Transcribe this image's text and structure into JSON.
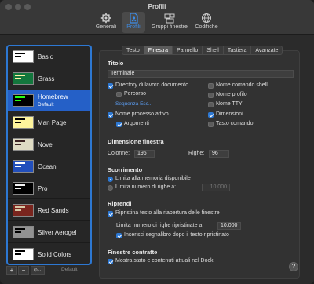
{
  "window": {
    "title": "Profili"
  },
  "toolbar": {
    "items": [
      {
        "label": "Generali",
        "icon": "gear-icon"
      },
      {
        "label": "Profili",
        "icon": "profile-doc-icon"
      },
      {
        "label": "Gruppi finestre",
        "icon": "window-groups-icon"
      },
      {
        "label": "Codifiche",
        "icon": "globe-icon"
      }
    ],
    "selected": "Profili"
  },
  "sidebar": {
    "profiles": [
      {
        "name": "Basic",
        "bg": "#ffffff",
        "fg": "#000000"
      },
      {
        "name": "Grass",
        "bg": "#13773d",
        "fg": "#fff0a5"
      },
      {
        "name": "Homebrew",
        "bg": "#000000",
        "fg": "#28fe14",
        "default_label": "Default"
      },
      {
        "name": "Man Page",
        "bg": "#fef49c",
        "fg": "#000000"
      },
      {
        "name": "Novel",
        "bg": "#dfdbc3",
        "fg": "#3b2322"
      },
      {
        "name": "Ocean",
        "bg": "#224fbc",
        "fg": "#ffffff"
      },
      {
        "name": "Pro",
        "bg": "#000000",
        "fg": "#f2f2f2"
      },
      {
        "name": "Red Sands",
        "bg": "#7a251e",
        "fg": "#d7c9a7"
      },
      {
        "name": "Silver Aerogel",
        "bg": "#929292",
        "fg": "#000000"
      },
      {
        "name": "Solid Colors",
        "bg": "#ffffff",
        "fg": "#000000"
      }
    ],
    "selected": "Homebrew",
    "add_label": "+",
    "remove_label": "−",
    "more_label": "⊙⌄",
    "default_button": "Default"
  },
  "tabs": [
    "Testo",
    "Finestra",
    "Pannello",
    "Shell",
    "Tastiera",
    "Avanzate"
  ],
  "selected_tab": "Finestra",
  "titolo": {
    "heading": "Titolo",
    "value": "Terminale",
    "options": {
      "directory": {
        "label": "Directory di lavoro documento",
        "checked": true
      },
      "percorso": {
        "label": "Percorso",
        "checked": false
      },
      "sequenza": {
        "label": "Sequenza Esc..."
      },
      "nome_processo": {
        "label": "Nome processo attivo",
        "checked": true
      },
      "argomenti": {
        "label": "Argomenti",
        "checked": true
      },
      "nome_comando_shell": {
        "label": "Nome comando shell",
        "checked": false
      },
      "nome_profilo": {
        "label": "Nome profilo",
        "checked": false
      },
      "nome_tty": {
        "label": "Nome TTY",
        "checked": false
      },
      "dimensioni": {
        "label": "Dimensioni",
        "checked": true
      },
      "tasto_comando": {
        "label": "Tasto comando",
        "checked": false
      }
    }
  },
  "dimensione": {
    "heading": "Dimensione finestra",
    "colonne_label": "Colonne:",
    "colonne_value": "196",
    "righe_label": "Righe:",
    "righe_value": "96"
  },
  "scorrimento": {
    "heading": "Scorrimento",
    "limita_memoria": {
      "label": "Limita alla memoria disponibile",
      "selected": true
    },
    "limita_righe": {
      "label": "Limita numero di righe a:",
      "selected": false,
      "value": "10.000"
    }
  },
  "riprendi": {
    "heading": "Riprendi",
    "ripristina": {
      "label": "Ripristina testo alla riapertura delle finestre",
      "checked": true
    },
    "limite_label": "Limita numero di righe ripristinate a:",
    "limite_value": "10.000",
    "segnalibro": {
      "label": "Inserisci segnalibro dopo il testo ripristinato",
      "checked": true
    }
  },
  "contratte": {
    "heading": "Finestre contratte",
    "mostra": {
      "label": "Mostra stato e contenuti attuali nel Dock",
      "checked": true
    }
  },
  "help_label": "?"
}
